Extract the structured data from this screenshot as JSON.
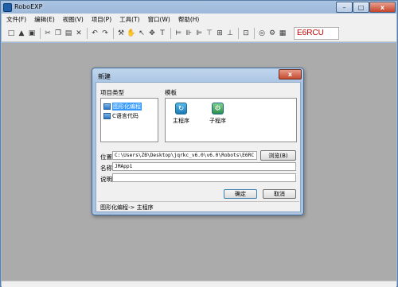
{
  "app": {
    "title": "RoboEXP",
    "menus": [
      "文件(F)",
      "编辑(E)",
      "视图(V)",
      "项目(P)",
      "工具(T)",
      "窗口(W)",
      "帮助(H)"
    ],
    "robot_code": "E6RCU",
    "colors": {
      "robot_code": "#c00000",
      "workspace": "#ababab"
    }
  },
  "window_controls": {
    "minimize": "–",
    "maximize": "□",
    "close": "x"
  },
  "toolbar": {
    "icons": [
      "new-icon",
      "open-icon",
      "save-icon",
      "cut-icon",
      "copy-icon",
      "paste-icon",
      "delete-icon",
      "undo-icon",
      "redo-icon",
      "tool-icon",
      "hand-icon",
      "pointer-icon",
      "move-icon",
      "text-icon",
      "align-left-icon",
      "align-center-icon",
      "align-right-icon",
      "align-top-icon",
      "align-middle-icon",
      "align-bottom-icon",
      "zoom-icon",
      "run-icon",
      "robot-icon",
      "settings-icon"
    ],
    "glyphs": [
      "□",
      "▲",
      "▣",
      "✂",
      "❐",
      "▤",
      "✕",
      "↶",
      "↷",
      "⚒",
      "✋",
      "↖",
      "✥",
      "T",
      "⊨",
      "⊪",
      "⊫",
      "⊤",
      "⊞",
      "⊥",
      "⊡",
      "◎",
      "⚙",
      "▦"
    ]
  },
  "dialog": {
    "title": "新建",
    "close_label": "x",
    "project_type_label": "项目类型",
    "project_types": [
      {
        "label": "图形化编程",
        "selected": true
      },
      {
        "label": "C语言代码",
        "selected": false
      }
    ],
    "template_label": "模板",
    "templates": [
      {
        "label": "主程序",
        "icon": "main-program-icon"
      },
      {
        "label": "子程序",
        "icon": "sub-program-icon"
      }
    ],
    "location_label": "位置",
    "location_value": "C:\\Users\\ZB\\Desktop\\jqrkc_v6.0\\v6.0\\Robots\\E6RC",
    "browse_label": "浏览(B)",
    "name_label": "名称",
    "name_value": "JMApp1",
    "desc_label": "说明",
    "desc_value": "",
    "ok_label": "确定",
    "cancel_label": "取消",
    "status": "图形化编程-> 主程序"
  }
}
